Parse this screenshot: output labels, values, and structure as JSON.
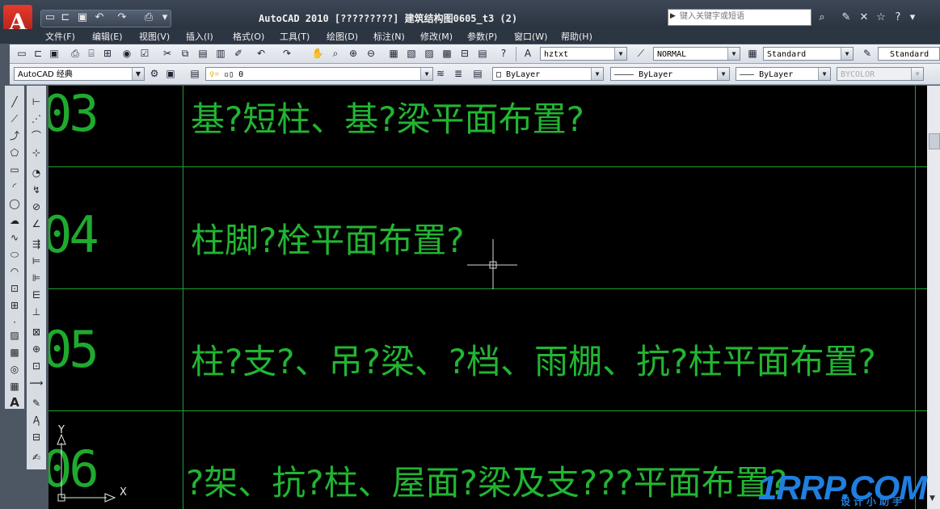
{
  "titlebar": {
    "app_logo": "A",
    "window_title": "AutoCAD 2010  [?????????] 建筑结构图0605_t3 (2)",
    "search_placeholder": "键入关键字或短语"
  },
  "menu": [
    "文件(F)",
    "编辑(E)",
    "视图(V)",
    "插入(I)",
    "格式(O)",
    "工具(T)",
    "绘图(D)",
    "标注(N)",
    "修改(M)",
    "参数(P)",
    "窗口(W)",
    "帮助(H)"
  ],
  "toolbar2": {
    "workspace": "AutoCAD 经典",
    "layer": "0",
    "color": "ByLayer",
    "linetype": "ByLayer",
    "lineweight": "ByLayer",
    "plotstyle": "BYCOLOR"
  },
  "toolbar1": {
    "textstyle": "hztxt",
    "dimstyle": "NORMAL",
    "tablestyle": "Standard",
    "mleaderstyle": "Standard"
  },
  "drawing": {
    "rows": [
      {
        "num": "03",
        "text": "基?短柱、基?梁平面布置?"
      },
      {
        "num": "04",
        "text": "柱脚?栓平面布置?"
      },
      {
        "num": "05",
        "text": "柱?支?、吊?梁、?档、雨棚、抗?柱平面布置?"
      },
      {
        "num": "06",
        "text": "?架、抗?柱、屋面?梁及支???平面布置?"
      }
    ],
    "ucs_y": "Y",
    "ucs_x": "X"
  },
  "watermark": {
    "brand": "1RRP.COM",
    "sub": "设计小助手"
  },
  "colors": {
    "line": "#1fa02c",
    "text": "#22b532",
    "canvas": "#000000",
    "watermark": "#1f7fe0"
  }
}
